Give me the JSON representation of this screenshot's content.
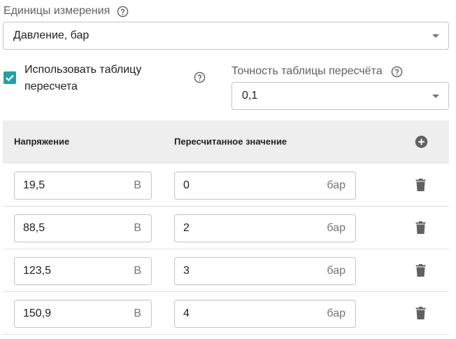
{
  "units": {
    "label": "Единицы измерения",
    "selected": "Давление, бар"
  },
  "conversion": {
    "checked": true,
    "label": "Использовать таблицу пересчета"
  },
  "precision": {
    "label": "Точность таблицы пересчёта",
    "selected": "0,1"
  },
  "table": {
    "headers": {
      "voltage": "Напряжение",
      "converted": "Пересчитанное значение"
    },
    "rows": [
      {
        "voltage": "19,5",
        "voltage_unit": "В",
        "converted": "0",
        "converted_unit": "бар"
      },
      {
        "voltage": "88,5",
        "voltage_unit": "В",
        "converted": "2",
        "converted_unit": "бар"
      },
      {
        "voltage": "123,5",
        "voltage_unit": "В",
        "converted": "3",
        "converted_unit": "бар"
      },
      {
        "voltage": "150,9",
        "voltage_unit": "В",
        "converted": "4",
        "converted_unit": "бар"
      }
    ]
  },
  "icons": {
    "help": "help-circle-outline-icon",
    "dropdown": "dropdown-arrow-icon",
    "checkbox": "checkbox-checked-icon",
    "add": "add-circle-icon",
    "delete": "trash-icon"
  },
  "colors": {
    "accent": "#26a0a8",
    "header_bg": "#eeeeee",
    "icon_gray": "#616161"
  }
}
